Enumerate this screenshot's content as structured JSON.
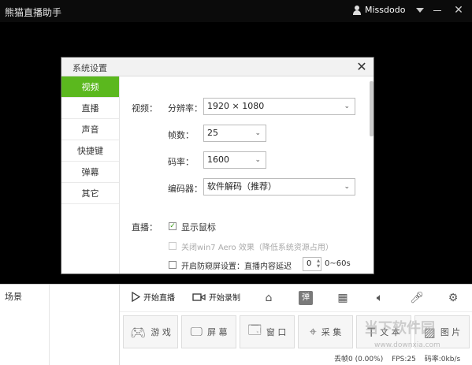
{
  "app": {
    "title": "熊猫直播助手",
    "username": "Missdodo"
  },
  "dialog": {
    "title": "系统设置",
    "nav": [
      {
        "label": "视频",
        "active": true
      },
      {
        "label": "直播",
        "active": false
      },
      {
        "label": "声音",
        "active": false
      },
      {
        "label": "快捷键",
        "active": false
      },
      {
        "label": "弹幕",
        "active": false
      },
      {
        "label": "其它",
        "active": false
      }
    ],
    "video": {
      "section_label": "视频：",
      "resolution_label": "分辨率：",
      "resolution_value": "1920 × 1080",
      "fps_label": "帧数：",
      "fps_value": "25",
      "bitrate_label": "码率：",
      "bitrate_value": "1600",
      "encoder_label": "编码器：",
      "encoder_value": "软件解码（推荐）"
    },
    "live": {
      "section_label": "直播：",
      "show_cursor": {
        "label": "显示鼠标",
        "checked": true
      },
      "disable_aero": {
        "label": "关闭win7 Aero 效果（降低系统资源占用）",
        "checked": false,
        "disabled": true
      },
      "anti_peek": {
        "label": "开启防窥屏设置：直播内容延迟",
        "checked": false
      },
      "delay_value": "0",
      "delay_range": "0~60s"
    }
  },
  "bottom": {
    "scene_label": "场景",
    "toolbar": {
      "start_live": "开始直播",
      "start_record": "开始录制"
    },
    "sources": [
      {
        "label": "游 戏",
        "icon": "gamepad-icon"
      },
      {
        "label": "屏 幕",
        "icon": "monitor-icon"
      },
      {
        "label": "窗 口",
        "icon": "window-icon"
      },
      {
        "label": "采 集",
        "icon": "location-icon"
      },
      {
        "label": "文 本",
        "icon": "text-icon"
      },
      {
        "label": "图 片",
        "icon": "image-icon"
      }
    ],
    "status": {
      "dropped": "丢帧0 (0.00%)",
      "fps": "FPS:25",
      "bitrate": "码率:0kb/s"
    }
  },
  "watermark": {
    "text": "当下软件园",
    "url": "www.downxia.com"
  }
}
